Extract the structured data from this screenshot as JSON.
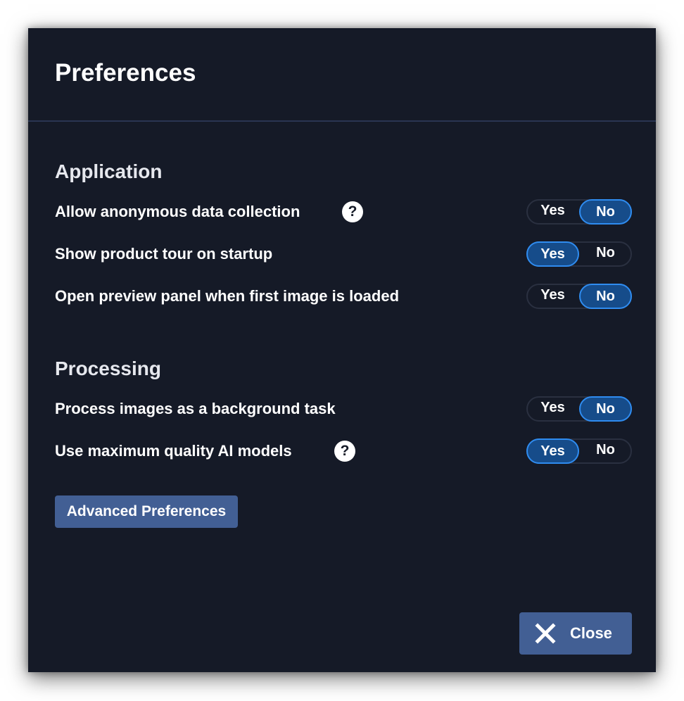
{
  "dialog": {
    "title": "Preferences"
  },
  "sections": {
    "application": {
      "title": "Application",
      "settings": [
        {
          "label": "Allow anonymous data collection",
          "has_help": true,
          "value": "No"
        },
        {
          "label": "Show product tour on startup",
          "has_help": false,
          "value": "Yes"
        },
        {
          "label": "Open preview panel when first image is loaded",
          "has_help": false,
          "value": "No"
        }
      ]
    },
    "processing": {
      "title": "Processing",
      "settings": [
        {
          "label": "Process images as a background task",
          "has_help": false,
          "value": "No"
        },
        {
          "label": "Use maximum quality AI models",
          "has_help": true,
          "value": "Yes"
        }
      ]
    }
  },
  "toggle": {
    "yes_label": "Yes",
    "no_label": "No"
  },
  "help": {
    "glyph": "?"
  },
  "buttons": {
    "advanced_label": "Advanced Preferences",
    "close_label": "Close"
  },
  "icons": {
    "help": "question-circle-icon",
    "close": "x-close-icon"
  },
  "colors": {
    "dialog_bg": "#151a27",
    "accent_active": "#164c8a",
    "accent_border": "#2f8cf0",
    "button_bg": "#425f94"
  }
}
